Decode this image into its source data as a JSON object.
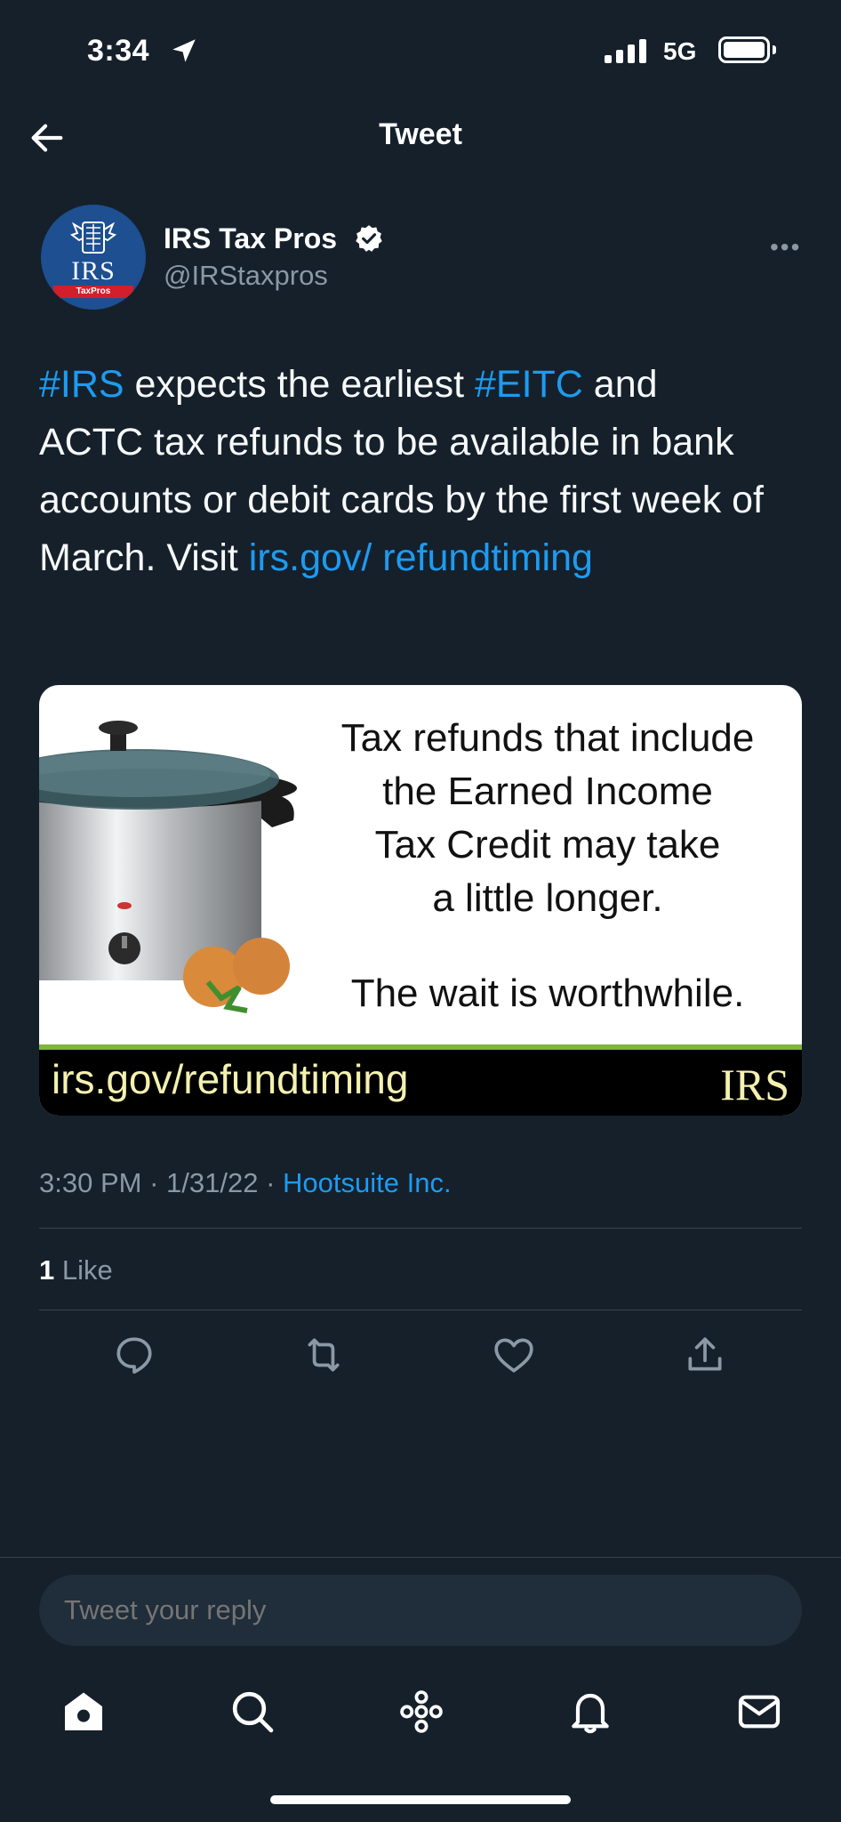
{
  "status_bar": {
    "time": "3:34",
    "network": "5G"
  },
  "header": {
    "title": "Tweet"
  },
  "author": {
    "name": "IRS Tax Pros",
    "handle": "@IRStaxpros",
    "avatar_text": "IRS",
    "avatar_band": "TaxPros"
  },
  "tweet": {
    "hashtag1": "#IRS",
    "text1": " expects the earliest ",
    "hashtag2": "#EITC",
    "text2": " and ACTC tax refunds to be available in bank accounts or debit cards by the first week of March. Visit ",
    "link": "irs.gov/ refundtiming"
  },
  "media": {
    "message_lines": [
      "Tax refunds that include",
      "the Earned Income",
      "Tax Credit may take",
      "a little longer."
    ],
    "message_2": "The wait is worthwhile.",
    "url": "irs.gov/refundtiming",
    "logo": "IRS"
  },
  "meta": {
    "time": "3:30 PM",
    "date": "1/31/22",
    "source": "Hootsuite Inc."
  },
  "stats": {
    "like_count": "1",
    "like_label": "Like"
  },
  "reply": {
    "placeholder": "Tweet your reply"
  },
  "actions": [
    "reply-icon",
    "retweet-icon",
    "like-icon",
    "share-icon"
  ],
  "tabs": [
    "home-icon",
    "search-icon",
    "spaces-icon",
    "notifications-icon",
    "messages-icon"
  ],
  "colors": {
    "background": "#15202b",
    "link": "#1d9bf0",
    "muted": "#8b98a5",
    "divider": "#38444d"
  }
}
